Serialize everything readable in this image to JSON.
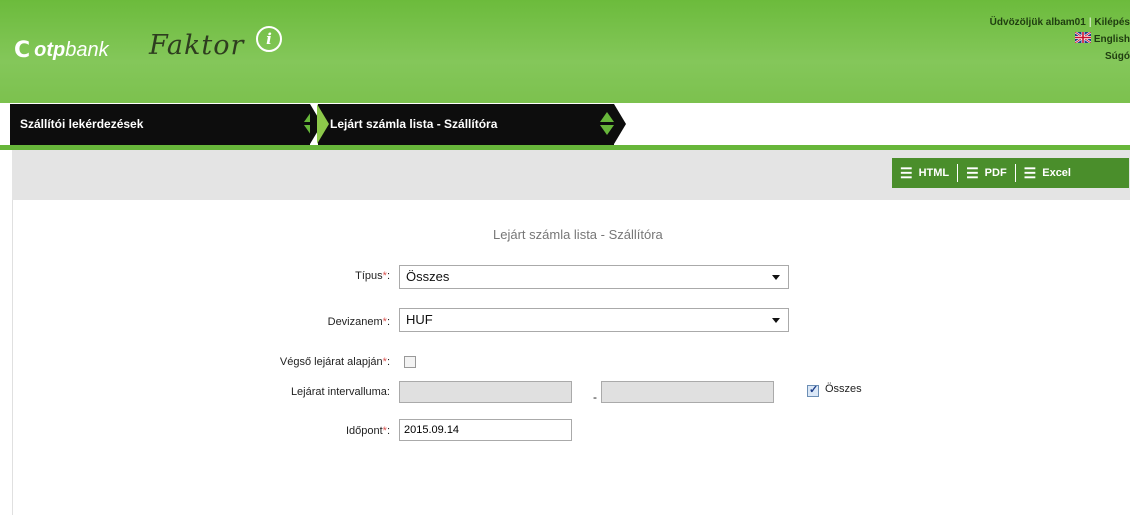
{
  "header": {
    "logo_symbol": "C",
    "logo_brand_bold": "otp",
    "logo_brand_rest": "bank",
    "app_name": "Faktor",
    "app_name_badge": "i",
    "greeting": "Üdvözöljük albam01",
    "separator": "|",
    "logout": "Kilépés",
    "language": "English",
    "help": "Súgó"
  },
  "breadcrumb": {
    "items": [
      {
        "label": "Szállítói lekérdezések"
      },
      {
        "label": "Lejárt számla lista - Szállítóra"
      }
    ]
  },
  "toolbar": {
    "html_label": "HTML",
    "pdf_label": "PDF",
    "excel_label": "Excel",
    "list_glyph": "☰"
  },
  "form": {
    "title": "Lejárt számla lista - Szállítóra",
    "required_mark": "*",
    "tipus": {
      "label": "Típus",
      "suffix": ":",
      "value": "Összes"
    },
    "devizanem": {
      "label": "Devizanem",
      "suffix": ":",
      "value": "HUF"
    },
    "vegso_lejarat": {
      "label": "Végső lejárat alapján",
      "suffix": ":",
      "checked": false
    },
    "lejarat_intervallum": {
      "label": "Lejárat intervalluma:",
      "from": "",
      "to": "",
      "dash": "-",
      "all_label": "Összes",
      "all_checked": true
    },
    "idopont": {
      "label": "Időpont",
      "suffix": ":",
      "value": "2015.09.14"
    }
  },
  "colors": {
    "header_green": "#7cc14e",
    "accent_green": "#4a8e2b",
    "breadcrumb_black": "#0d0d0d"
  }
}
